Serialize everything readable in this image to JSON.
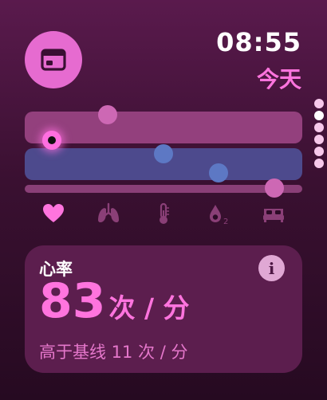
{
  "header": {
    "time": "08:55",
    "date_label": "今天",
    "app_icon": "calendar-icon"
  },
  "page_indicator": {
    "count": 6,
    "active_index": 1
  },
  "metrics": [
    {
      "name": "heart-icon",
      "color": "#ff74de"
    },
    {
      "name": "lungs-icon",
      "color": "#8a3f77"
    },
    {
      "name": "thermometer-icon",
      "color": "#8a3f77"
    },
    {
      "name": "blood-oxygen-icon",
      "color": "#8a3f77"
    },
    {
      "name": "bed-icon",
      "color": "#8a3f77"
    }
  ],
  "card": {
    "title": "心率",
    "value": "83",
    "unit": "次 / 分",
    "note": "高于基线 11 次 / 分",
    "info_label": "i"
  },
  "colors": {
    "accent": "#ff74de",
    "lane_top": "#93407d",
    "lane_mid": "#4d4a8d",
    "card_bg": "#5c1e4e"
  }
}
